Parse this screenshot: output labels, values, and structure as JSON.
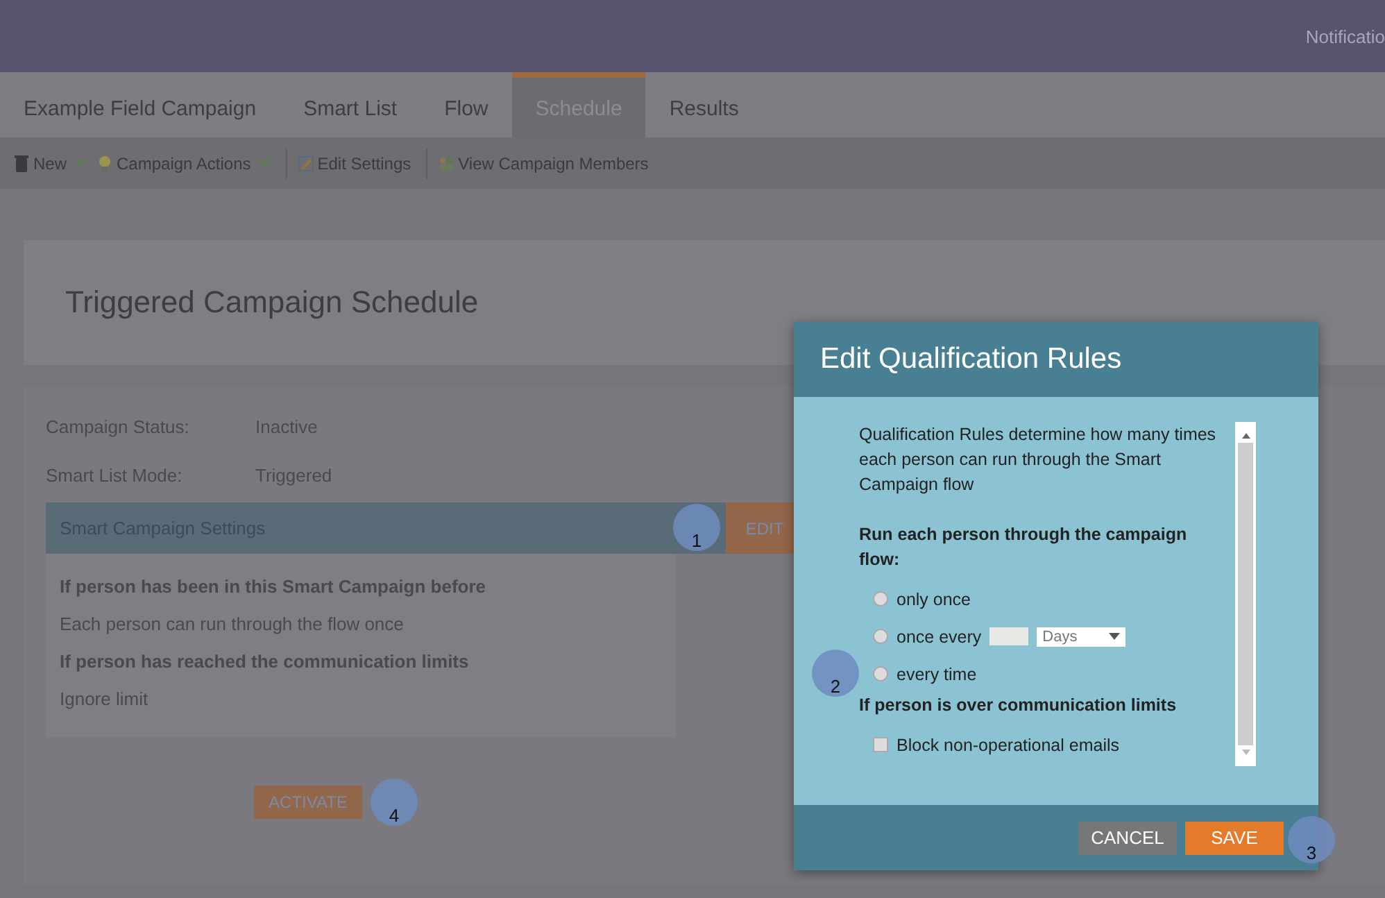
{
  "top_bar": {
    "notification": "Notificatio"
  },
  "tabs": [
    {
      "label": "Example Field Campaign",
      "selected": false
    },
    {
      "label": "Smart List",
      "selected": false
    },
    {
      "label": "Flow",
      "selected": false
    },
    {
      "label": "Schedule",
      "selected": true
    },
    {
      "label": "Results",
      "selected": false
    }
  ],
  "toolbar": [
    {
      "label": "New",
      "kind": "trash",
      "dropdown": true
    },
    {
      "label": "Campaign Actions",
      "kind": "bulb",
      "dropdown": true
    },
    {
      "label": "Edit Settings",
      "kind": "pencil",
      "dropdown": false
    },
    {
      "label": "View Campaign Members",
      "kind": "people",
      "dropdown": false
    }
  ],
  "schedule": {
    "title": "Triggered Campaign Schedule",
    "fields": [
      {
        "label": "Campaign Status:",
        "value": "Inactive"
      },
      {
        "label": "Smart List Mode:",
        "value": "Triggered"
      }
    ],
    "settings": {
      "title": "Smart Campaign Settings",
      "edit_button": "EDIT",
      "step": "1",
      "lines": [
        {
          "text": "If person has been in this Smart Campaign before",
          "kind": "heading"
        },
        {
          "text": "Each person can run through the flow once",
          "kind": "value"
        },
        {
          "text": "If person has reached the communication limits",
          "kind": "heading"
        },
        {
          "text": "Ignore limit",
          "kind": "value"
        }
      ]
    },
    "activate_button": "ACTIVATE",
    "activate_step": "4"
  },
  "dialog": {
    "title": "Edit Qualification Rules",
    "intro": "Qualification Rules determine how many times each person can run through the Smart Campaign flow",
    "run_heading": "Run each person through the campaign flow:",
    "options": [
      {
        "label": "only once",
        "selected": false,
        "kind": "plain"
      },
      {
        "label": "once every",
        "selected": false,
        "kind": "interval",
        "unit": "Days"
      },
      {
        "label": "every time",
        "selected": false,
        "kind": "plain",
        "step": "2"
      }
    ],
    "limits_heading": "If person is over communication limits",
    "block": {
      "label": "Block non-operational emails",
      "checked": false
    },
    "cancel": "CANCEL",
    "save": "SAVE",
    "save_step": "3"
  }
}
